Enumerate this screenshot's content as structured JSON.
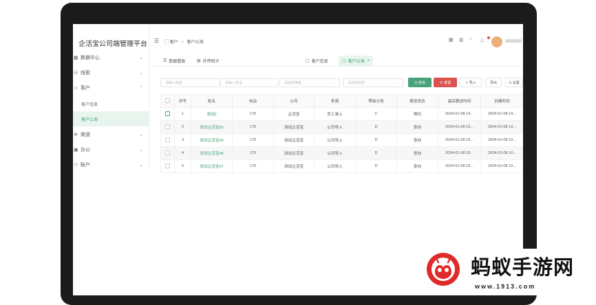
{
  "brand": "企活宝公司端管理平台",
  "sidebar": {
    "items": [
      {
        "label": "数据中心",
        "icon": "database-icon",
        "glyph": "▦"
      },
      {
        "label": "线索",
        "icon": "clue-icon",
        "glyph": "☷"
      },
      {
        "label": "客户",
        "icon": "customer-icon",
        "glyph": "☺"
      },
      {
        "label": "渠道",
        "icon": "channel-icon",
        "glyph": "✣"
      },
      {
        "label": "办公",
        "icon": "office-icon",
        "glyph": "▣"
      },
      {
        "label": "账户",
        "icon": "account-icon",
        "glyph": "⚇"
      }
    ],
    "sub_items": [
      {
        "label": "客户信息",
        "active": false
      },
      {
        "label": "客户公海",
        "active": true
      }
    ]
  },
  "header": {
    "breadcrumb": [
      "客户",
      "客户公海"
    ]
  },
  "tabs": [
    {
      "label": "数据看板",
      "icon": "list-icon",
      "glyph": "☰"
    },
    {
      "label": "外呼统计",
      "icon": "stats-icon",
      "glyph": "▤"
    },
    {
      "label": "客户信息",
      "icon": "customer-info-icon",
      "glyph": "▢"
    },
    {
      "label": "客户公海",
      "icon": "customer-pool-icon",
      "glyph": "▢",
      "close": "×"
    }
  ],
  "filters": {
    "name_placeholder": "请输入姓名",
    "phone_placeholder": "请输入电话",
    "grade_placeholder": "请选择等级",
    "status_placeholder": "请选择状态"
  },
  "buttons": {
    "search": "Q 查询",
    "reset": "⊘ 重置",
    "import": "⇪ 导入",
    "export": "导出",
    "config": "☷ 设置"
  },
  "table": {
    "columns": [
      "序号",
      "姓名",
      "电话",
      "公司",
      "来源",
      "等级分类",
      "跟进状态",
      "最后跟进时间",
      "创建时间"
    ],
    "rows": [
      {
        "no": "1",
        "name": "测试2",
        "phone": "170",
        "company": "企活宝",
        "source": "员工录入",
        "grade": "C",
        "status": "预约",
        "last_follow": "2024-01-08 14...",
        "created": "2024-01-08 14..."
      },
      {
        "no": "2",
        "name": "测试企活宝50",
        "phone": "170",
        "company": "测试企活宝",
        "source": "公司导入",
        "grade": "D",
        "status": "意向",
        "last_follow": "2024-01-08 10...",
        "created": "2024-01-08 10..."
      },
      {
        "no": "3",
        "name": "测试企活宝49",
        "phone": "170",
        "company": "测试企活宝",
        "source": "公司导入",
        "grade": "D",
        "status": "意向",
        "last_follow": "2024-01-08 10...",
        "created": "2024-01-08 10..."
      },
      {
        "no": "4",
        "name": "测试企活宝48",
        "phone": "170",
        "company": "测试企活宝",
        "source": "公司导入",
        "grade": "D",
        "status": "意向",
        "last_follow": "2024-01-08 10...",
        "created": "2024-01-08 10..."
      },
      {
        "no": "5",
        "name": "测试企活宝47",
        "phone": "170",
        "company": "测试企活宝",
        "source": "公司导入",
        "grade": "D",
        "status": "意向",
        "last_follow": "2024-01-08 10...",
        "created": "2024-01-08 10..."
      }
    ]
  },
  "watermark": {
    "title": "蚂蚁手游网",
    "url": "www.1913.com"
  },
  "colors": {
    "accent": "#48a37a",
    "danger": "#d9534f",
    "bezel": "#1b1b1b"
  }
}
